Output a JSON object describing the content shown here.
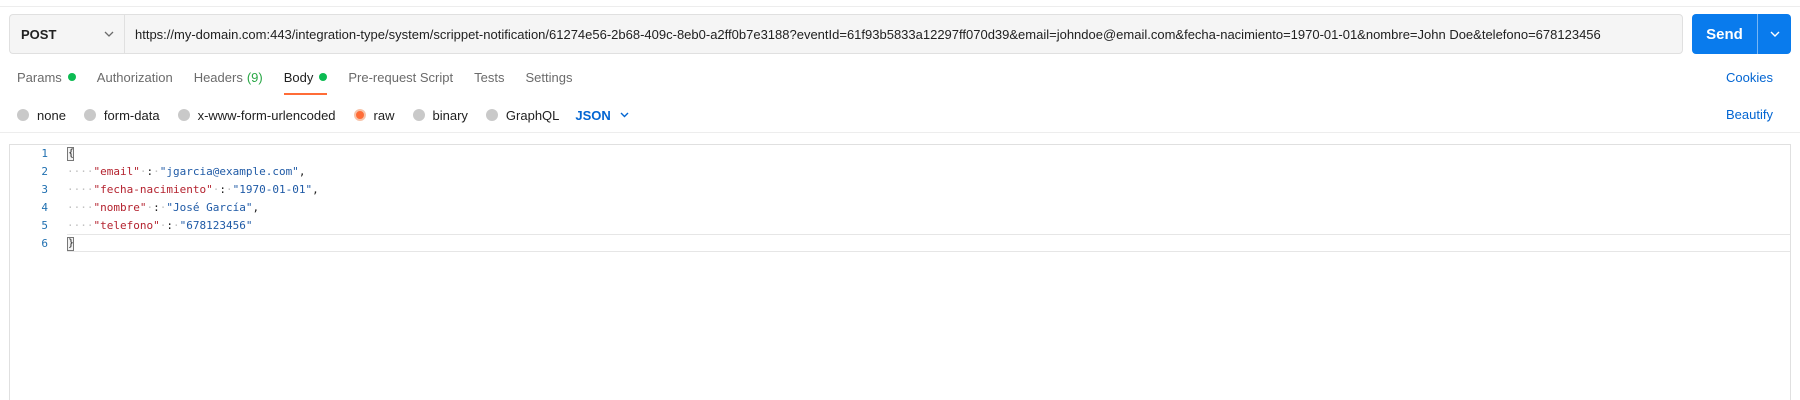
{
  "request": {
    "method": "POST",
    "url": "https://my-domain.com:443/integration-type/system/scrippet-notification/61274e56-2b68-409c-8eb0-a2ff0b7e3188?eventId=61f93b5833a12297ff070d39&email=johndoe@email.com&fecha-nacimiento=1970-01-01&nombre=John Doe&telefono=678123456",
    "send_label": "Send"
  },
  "tabs": [
    {
      "label": "Params",
      "dot": true
    },
    {
      "label": "Authorization"
    },
    {
      "label": "Headers",
      "count": "(9)"
    },
    {
      "label": "Body",
      "dot": true,
      "active": true
    },
    {
      "label": "Pre-request Script"
    },
    {
      "label": "Tests"
    },
    {
      "label": "Settings"
    }
  ],
  "cookies_label": "Cookies",
  "body_types": [
    {
      "label": "none",
      "selected": false
    },
    {
      "label": "form-data",
      "selected": false
    },
    {
      "label": "x-www-form-urlencoded",
      "selected": false
    },
    {
      "label": "raw",
      "selected": true
    },
    {
      "label": "binary",
      "selected": false
    },
    {
      "label": "GraphQL",
      "selected": false
    }
  ],
  "raw_format": "JSON",
  "beautify_label": "Beautify",
  "editor": {
    "line_numbers": [
      "1",
      "2",
      "3",
      "4",
      "5",
      "6"
    ],
    "lines": [
      {
        "key": "\"email\"",
        "value": "\"jgarcia@example.com\"",
        "comma": true
      },
      {
        "key": "\"fecha-nacimiento\"",
        "value": "\"1970-01-01\"",
        "comma": true
      },
      {
        "key": "\"nombre\"",
        "value": "\"José García\"",
        "comma": true
      },
      {
        "key": "\"telefono\"",
        "value": "\"678123456\"",
        "comma": false
      }
    ]
  },
  "colors": {
    "accent_tab": "#ff6c37",
    "send_button": "#097bed",
    "link": "#0265d2",
    "status_dot": "#0cbb52"
  }
}
